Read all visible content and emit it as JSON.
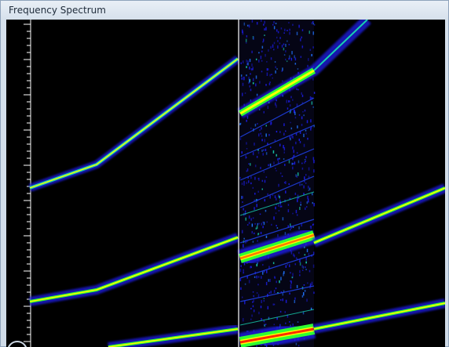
{
  "window": {
    "title": "Frequency Spectrum"
  },
  "display": {
    "type": "spectrogram",
    "background_color": "#000000",
    "divider_color": "#ffffff",
    "colormap": [
      "#1b1bd9",
      "#1f6ef2",
      "#18d1b0",
      "#30ff30",
      "#ffff00",
      "#ff7a00",
      "#ff2a00"
    ],
    "grid": false,
    "icons": [
      "resize-handle-icon"
    ]
  }
}
